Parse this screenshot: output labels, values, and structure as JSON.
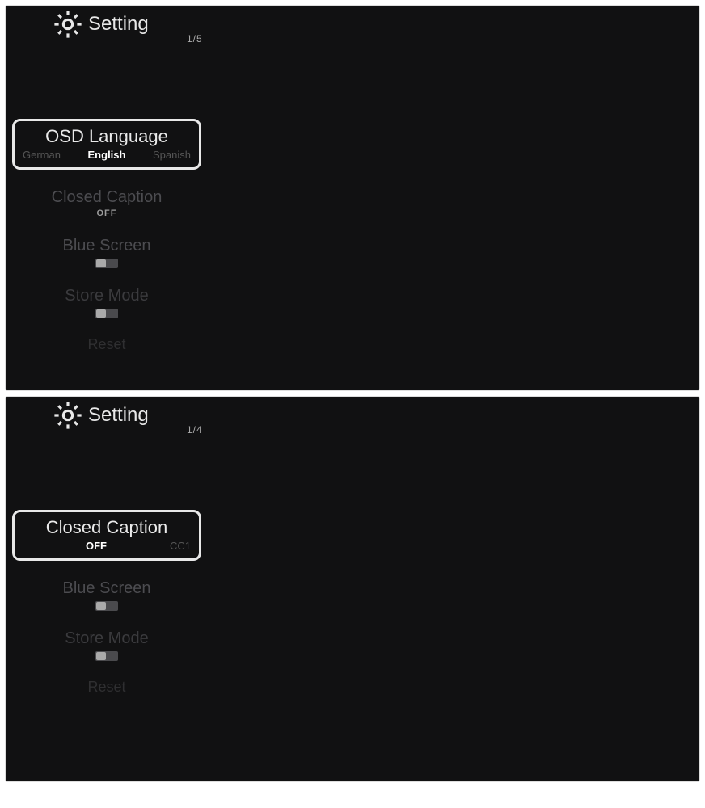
{
  "panel1": {
    "title": "Setting",
    "counter": "1/5",
    "selected": {
      "label": "OSD Language",
      "options": [
        "German",
        "English",
        "Spanish"
      ],
      "active": "English"
    },
    "items": [
      {
        "label": "Closed Caption",
        "value": "OFF"
      },
      {
        "label": "Blue Screen",
        "toggle": "left"
      },
      {
        "label": "Store Mode",
        "toggle": "left"
      },
      {
        "label": "Reset"
      }
    ]
  },
  "panel2": {
    "title": "Setting",
    "counter": "1/4",
    "selected": {
      "label": "Closed Caption",
      "options": [
        "",
        "OFF",
        "CC1"
      ],
      "active": "OFF"
    },
    "items": [
      {
        "label": "Blue Screen",
        "toggle": "left"
      },
      {
        "label": "Store Mode",
        "toggle": "left"
      },
      {
        "label": "Reset"
      }
    ]
  }
}
